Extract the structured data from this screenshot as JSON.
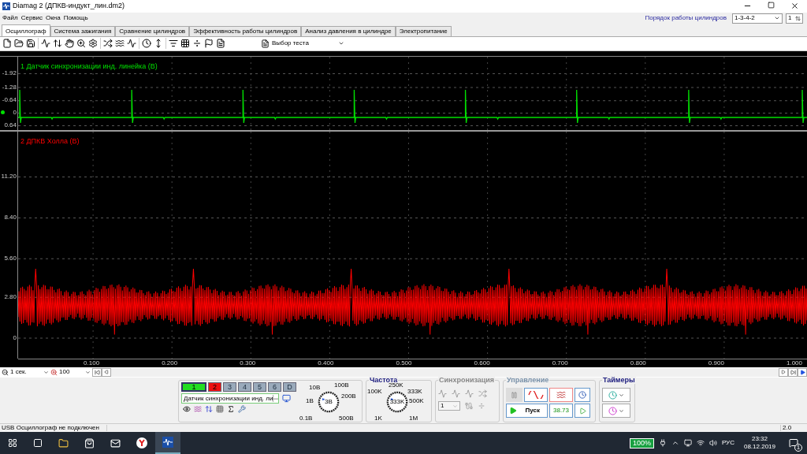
{
  "window": {
    "title": "Diamag 2 (ДПКВ-индукт_лин.dm2)"
  },
  "menu": [
    "Файл",
    "Сервис",
    "Окна",
    "Помощь"
  ],
  "cylinder_order": {
    "label": "Порядок работы цилиндров",
    "value": "1-3-4-2",
    "cylinder": "1"
  },
  "tabs": [
    {
      "label": "Осциллограф",
      "selected": true
    },
    {
      "label": "Система зажигания",
      "selected": false
    },
    {
      "label": "Сравнение цилиндров",
      "selected": false
    },
    {
      "label": "Эффективность работы цилиндров",
      "selected": false
    },
    {
      "label": "Анализ давления в цилиндре",
      "selected": false
    },
    {
      "label": "Электропитание",
      "selected": false
    }
  ],
  "test_select": {
    "label": "Выбор теста"
  },
  "channels": [
    {
      "title": "1 Датчик синхронизации инд. линейка (В)",
      "color": "#00e000",
      "kind": "spikes",
      "yticks": [
        "-1.92",
        "-1.28",
        "-0.64",
        "0",
        "0.64"
      ]
    },
    {
      "title": "2 ДПКВ Холла (В)",
      "color": "#ff0000",
      "kind": "noise",
      "yticks": [
        "11.20",
        "8.40",
        "5.60",
        "2.80",
        "0"
      ]
    }
  ],
  "xticks": [
    "0.100",
    "0.200",
    "0.300",
    "0.400",
    "0.500",
    "0.600",
    "0.700",
    "0.800",
    "0.900",
    "1.000"
  ],
  "time_scale": {
    "value": "1 сек."
  },
  "zoom": {
    "value": "100"
  },
  "channel_buttons": [
    {
      "label": "1",
      "on": true,
      "selected": true,
      "color": "#22dd22"
    },
    {
      "label": "2",
      "on": true,
      "selected": false,
      "color": "#ee1111"
    },
    {
      "label": "3",
      "on": false,
      "selected": false,
      "color": "#9aaabb"
    },
    {
      "label": "4",
      "on": false,
      "selected": false,
      "color": "#9aaabb"
    },
    {
      "label": "5",
      "on": false,
      "selected": false,
      "color": "#9aaabb"
    },
    {
      "label": "6",
      "on": false,
      "selected": false,
      "color": "#9aaabb"
    },
    {
      "label": "D",
      "on": false,
      "selected": false,
      "color": "#9aaabb"
    }
  ],
  "channel_source": {
    "value": "Датчик синхронизации инд. ли"
  },
  "voltage_knob": {
    "value": "3В",
    "labels": [
      "10В",
      "100В",
      "1В",
      "200В",
      "0.1В",
      "500В"
    ]
  },
  "frequency": {
    "title": "Частота",
    "value": "333K",
    "labels": [
      "100K",
      "250K",
      "333K",
      "500K",
      "1K",
      "1M"
    ]
  },
  "sync": {
    "title": "Синхронизация",
    "channel": "1"
  },
  "control": {
    "title": "Управление",
    "start": "Пуск",
    "reading": "38.73"
  },
  "timers": {
    "title": "Таймеры"
  },
  "status": {
    "message": "USB Осциллограф не подключен",
    "version": "2.0"
  },
  "taskbar": {
    "battery": "100%",
    "language": "РУС",
    "time": "23:32",
    "date": "08.12.2019",
    "notifications": "1"
  }
}
